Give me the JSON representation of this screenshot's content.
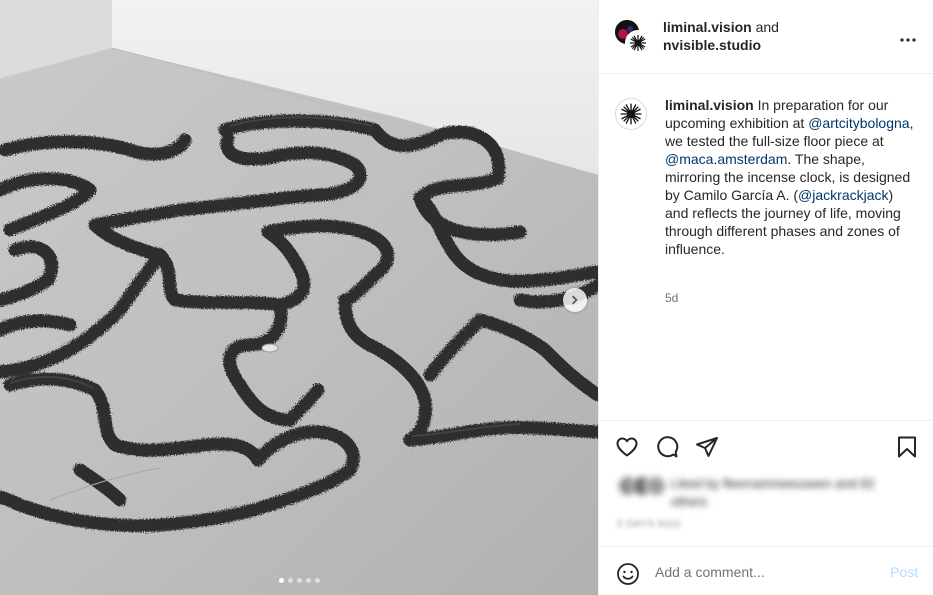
{
  "header": {
    "account1": "liminal.vision",
    "joiner": "and",
    "account2": "nvisible.studio",
    "more_icon": "more-horizontal-icon"
  },
  "caption": {
    "username": "liminal.vision",
    "seg1": " In preparation for our upcoming exhibition at ",
    "mention1": "@artcitybologna",
    "seg2": ", we tested the full-size floor piece at ",
    "mention2": "@maca.amsterdam",
    "seg3": ". The shape, mirroring the incense clock, is designed by Camilo García A. (",
    "mention3": "@jackrackjack",
    "seg4": ") and reflects the journey of life, moving through different phases and zones of influence.",
    "time": "5d"
  },
  "media": {
    "slide_count": 5,
    "active_slide": 1,
    "next_icon": "chevron-right-icon"
  },
  "actions": {
    "like_icon": "heart-icon",
    "comment_icon": "comment-icon",
    "share_icon": "send-icon",
    "save_icon": "bookmark-icon"
  },
  "likes": {
    "text": "Liked by fleerrammeeuseen and 82 others",
    "date": "5 DAYS AGO"
  },
  "comment": {
    "placeholder": "Add a comment...",
    "post_label": "Post",
    "emoji_icon": "emoji-icon"
  },
  "colors": {
    "link": "#00376b",
    "post_disabled": "#b3dbff",
    "border": "#efefef"
  }
}
